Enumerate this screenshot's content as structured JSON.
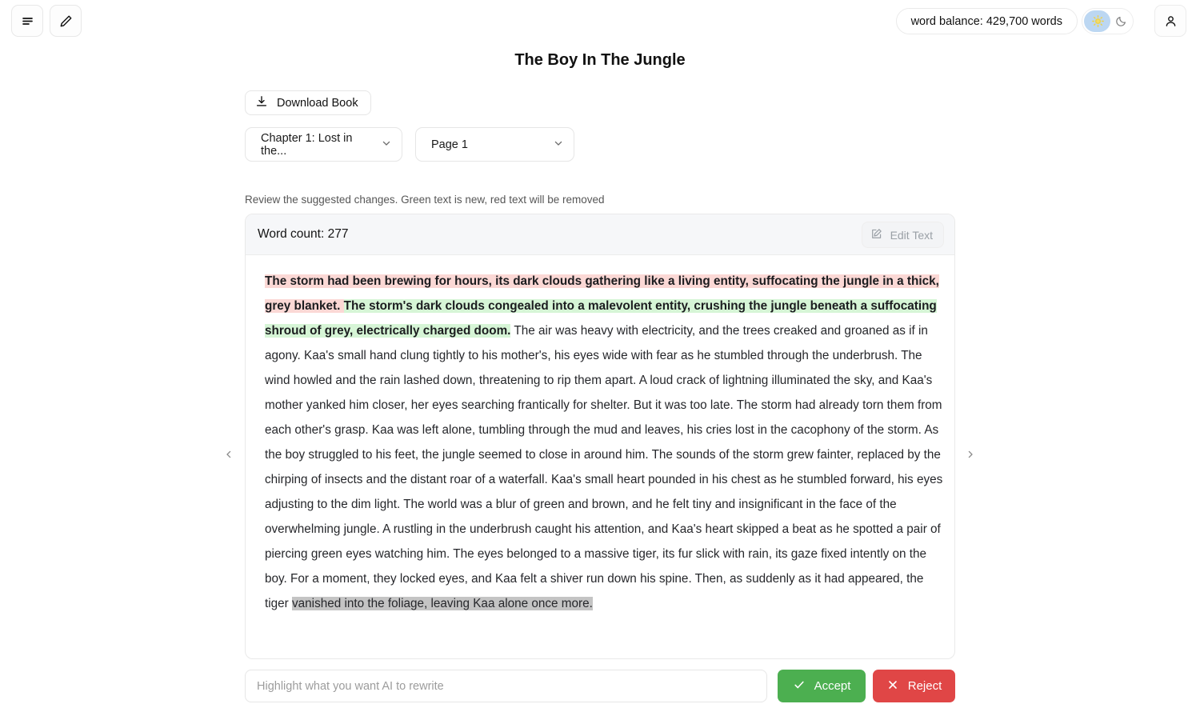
{
  "topbar": {
    "menu_icon": "menu-icon",
    "edit_icon": "pencil-icon",
    "word_balance": "word balance: 429,700 words",
    "theme_toggle": {
      "active": "light",
      "sun_icon": "sun-icon",
      "moon_icon": "moon-icon"
    },
    "user_icon": "user-icon"
  },
  "header": {
    "title": "The Boy In The Jungle",
    "download_label": "Download Book",
    "download_icon": "download-icon"
  },
  "selectors": {
    "chapter": {
      "value": "Chapter 1: Lost in the...",
      "chevron": "chevron-down-icon"
    },
    "page": {
      "value": "Page 1",
      "chevron": "chevron-down-icon"
    }
  },
  "review": {
    "hint": "Review the suggested changes. Green text is new, red text will be removed",
    "word_count": "Word count: 277",
    "edit_text_label": "Edit Text",
    "edit_text_icon": "pencil-square-icon",
    "colors": {
      "deleted_bg": "#fbd8d5",
      "inserted_bg": "#d6f5d6",
      "selection_bg": "#c4c4c4"
    }
  },
  "document": {
    "deleted": "The storm had been brewing for hours, its dark clouds gathering like a living entity, suffocating the jungle in a thick, grey blanket. ",
    "inserted": "The storm's dark clouds congealed into a malevolent entity, crushing the jungle beneath a suffocating shroud of grey, electrically charged doom.",
    "body": " The air was heavy with electricity, and the trees creaked and groaned as if in agony. Kaa's small hand clung tightly to his mother's, his eyes wide with fear as he stumbled through the underbrush. The wind howled and the rain lashed down, threatening to rip them apart. A loud crack of lightning illuminated the sky, and Kaa's mother yanked him closer, her eyes searching frantically for shelter. But it was too late. The storm had already torn them from each other's grasp. Kaa was left alone, tumbling through the mud and leaves, his cries lost in the cacophony of the storm. As the boy struggled to his feet, the jungle seemed to close in around him. The sounds of the storm grew fainter, replaced by the chirping of insects and the distant roar of a waterfall. Kaa's small heart pounded in his chest as he stumbled forward, his eyes adjusting to the dim light. The world was a blur of green and brown, and he felt tiny and insignificant in the face of the overwhelming jungle. A rustling in the underbrush caught his attention, and Kaa's heart skipped a beat as he spotted a pair of piercing green eyes watching him. The eyes belonged to a massive tiger, its fur slick with rain, its gaze fixed intently on the boy. For a moment, they locked eyes, and Kaa felt a shiver run down his spine. Then, as suddenly as it had appeared, the tiger ",
    "selected": "vanished into the foliage, leaving Kaa alone once more."
  },
  "navigation": {
    "prev_icon": "chevron-left-icon",
    "next_icon": "chevron-right-icon"
  },
  "footer": {
    "rewrite_placeholder": "Highlight what you want AI to rewrite",
    "rewrite_value": "",
    "accept_label": "Accept",
    "accept_icon": "check-icon",
    "reject_label": "Reject",
    "reject_icon": "x-icon"
  }
}
